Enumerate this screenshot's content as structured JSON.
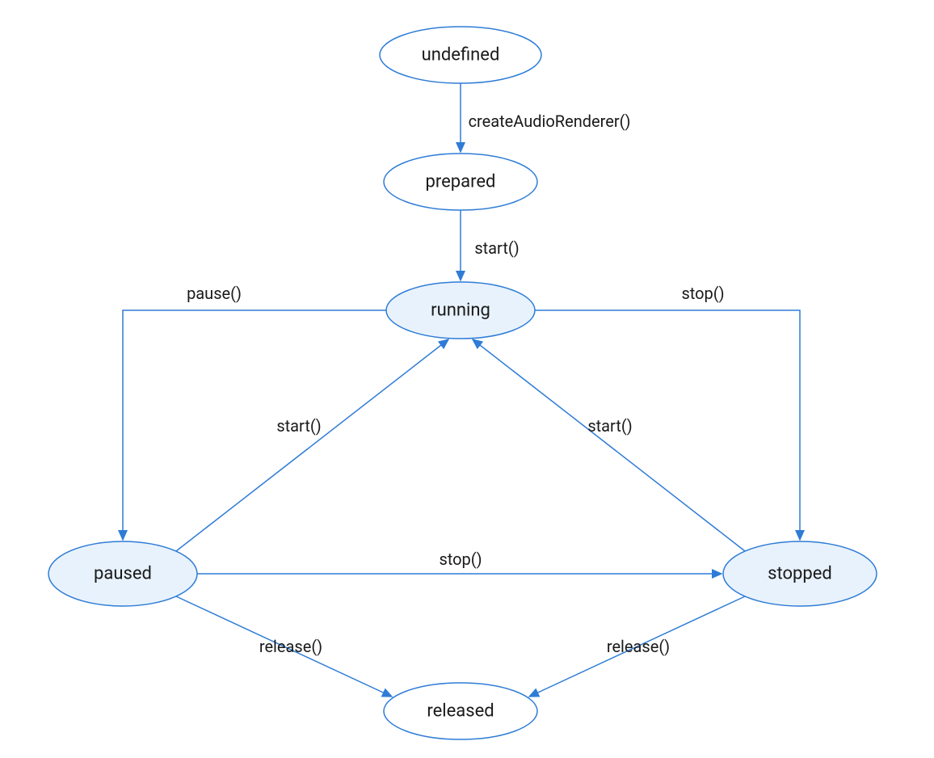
{
  "nodes": {
    "undefined": {
      "label": "undefined"
    },
    "prepared": {
      "label": "prepared"
    },
    "running": {
      "label": "running"
    },
    "paused": {
      "label": "paused"
    },
    "stopped": {
      "label": "stopped"
    },
    "released": {
      "label": "released"
    }
  },
  "edges": {
    "createAudioRenderer": {
      "label": "createAudioRenderer()"
    },
    "start_prepared": {
      "label": "start()"
    },
    "pause": {
      "label": "pause()"
    },
    "stop_running": {
      "label": "stop()"
    },
    "start_paused": {
      "label": "start()"
    },
    "start_stopped": {
      "label": "start()"
    },
    "stop_paused": {
      "label": "stop()"
    },
    "release_paused": {
      "label": "release()"
    },
    "release_stopped": {
      "label": "release()"
    }
  }
}
